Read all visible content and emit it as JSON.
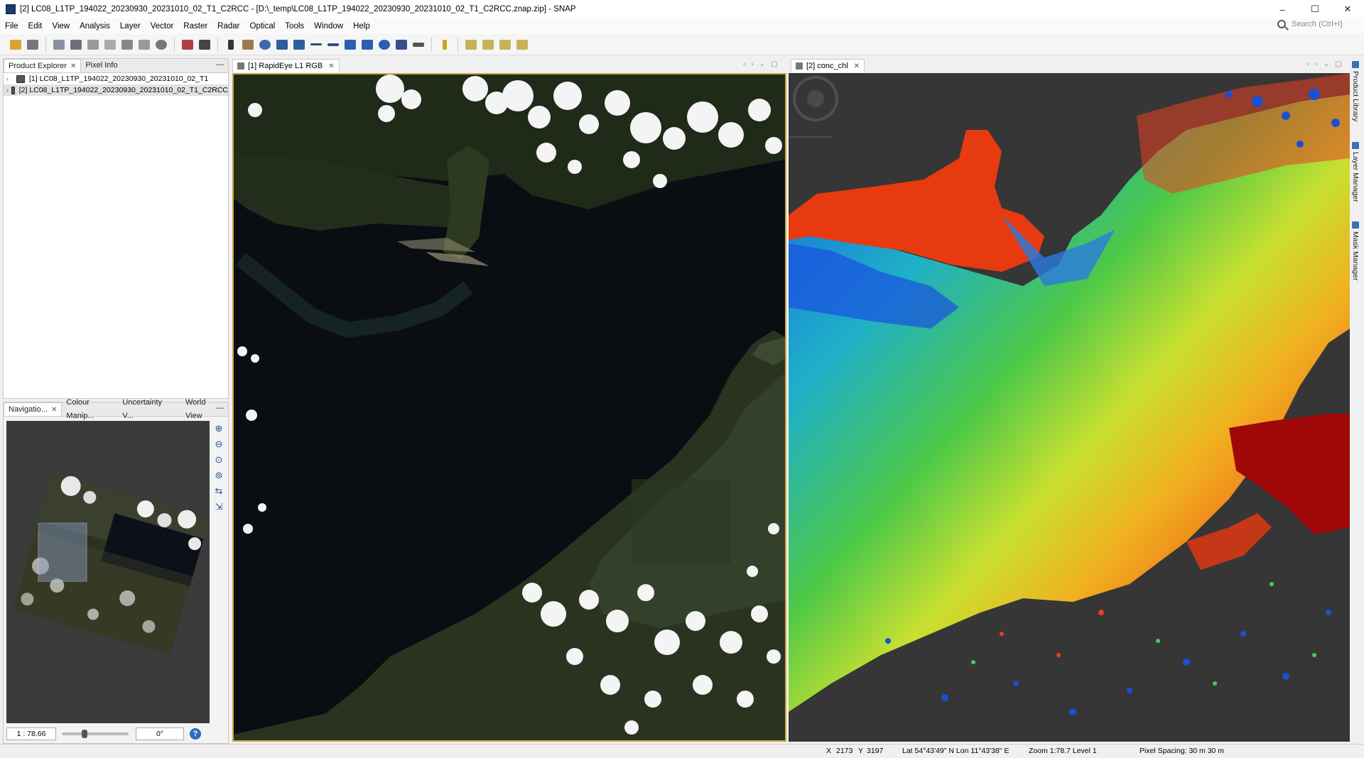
{
  "window": {
    "title": "[2] LC08_L1TP_194022_20230930_20231010_02_T1_C2RCC - [D:\\_temp\\LC08_L1TP_194022_20230930_20231010_02_T1_C2RCC.znap.zip] - SNAP",
    "controls": [
      "–",
      "☐",
      "✕"
    ]
  },
  "menu": [
    "File",
    "Edit",
    "View",
    "Analysis",
    "Layer",
    "Vector",
    "Raster",
    "Optical",
    "Tools",
    "Window",
    "Help"
  ],
  "menu_radar": "Radar",
  "search": {
    "placeholder": "Search (Ctrl+I)"
  },
  "product_explorer": {
    "tabs": [
      "Product Explorer",
      "Pixel Info"
    ],
    "products": [
      "[1] LC08_L1TP_194022_20230930_20231010_02_T1",
      "[2] LC08_L1TP_194022_20230930_20231010_02_T1_C2RCC"
    ]
  },
  "navigation": {
    "tabs": [
      "Navigatio...",
      "Colour Manip...",
      "Uncertainty V...",
      "World View"
    ],
    "scale": "1 : 78.66",
    "rotation": "0°"
  },
  "views": {
    "left_tab": "[1] RapidEye L1 RGB",
    "right_tab": "[2] conc_chl"
  },
  "side_tabs": [
    "Product Library",
    "Layer Manager",
    "Mask Manager"
  ],
  "status": {
    "x_label": "X",
    "x": "2173",
    "y_label": "Y",
    "y": "3197",
    "latlon": "Lat 54°43'49\" N  Lon 11°43'38\" E",
    "zoom": "Zoom 1:78.7  Level 1",
    "pixel_spacing": "Pixel Spacing: 30 m 30 m"
  },
  "colors": {
    "accent": "#c9a440",
    "water": "#0b0f14",
    "chl_low": "#1a6fe0",
    "chl_high": "#e02a10"
  }
}
